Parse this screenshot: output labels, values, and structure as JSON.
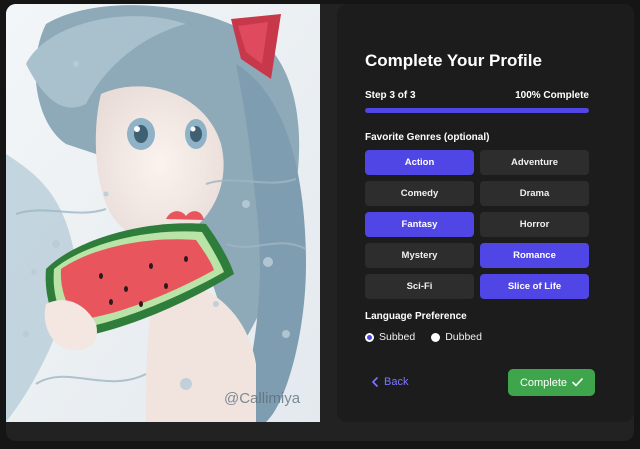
{
  "profile": {
    "title": "Complete Your Profile",
    "step_label": "Step 3 of 3",
    "percent_label": "100% Complete",
    "progress": 1.0
  },
  "genres": {
    "label": "Favorite Genres (optional)",
    "items": [
      {
        "label": "Action",
        "selected": true
      },
      {
        "label": "Adventure",
        "selected": false
      },
      {
        "label": "Comedy",
        "selected": false
      },
      {
        "label": "Drama",
        "selected": false
      },
      {
        "label": "Fantasy",
        "selected": true
      },
      {
        "label": "Horror",
        "selected": false
      },
      {
        "label": "Mystery",
        "selected": false
      },
      {
        "label": "Romance",
        "selected": true
      },
      {
        "label": "Sci-Fi",
        "selected": false
      },
      {
        "label": "Slice of Life",
        "selected": true
      }
    ]
  },
  "language": {
    "label": "Language Preference",
    "options": [
      {
        "label": "Subbed",
        "checked": true
      },
      {
        "label": "Dubbed",
        "checked": false
      }
    ]
  },
  "actions": {
    "back_label": "Back",
    "back_icon": "chevron-left-icon",
    "complete_label": "Complete",
    "complete_icon": "check-icon"
  },
  "artwork": {
    "watermark": "@Callimiya",
    "description_icon": "anime-illustration"
  },
  "colors": {
    "accent": "#4f46e5",
    "success": "#3ea54c",
    "panel": "#1c1c1c"
  }
}
